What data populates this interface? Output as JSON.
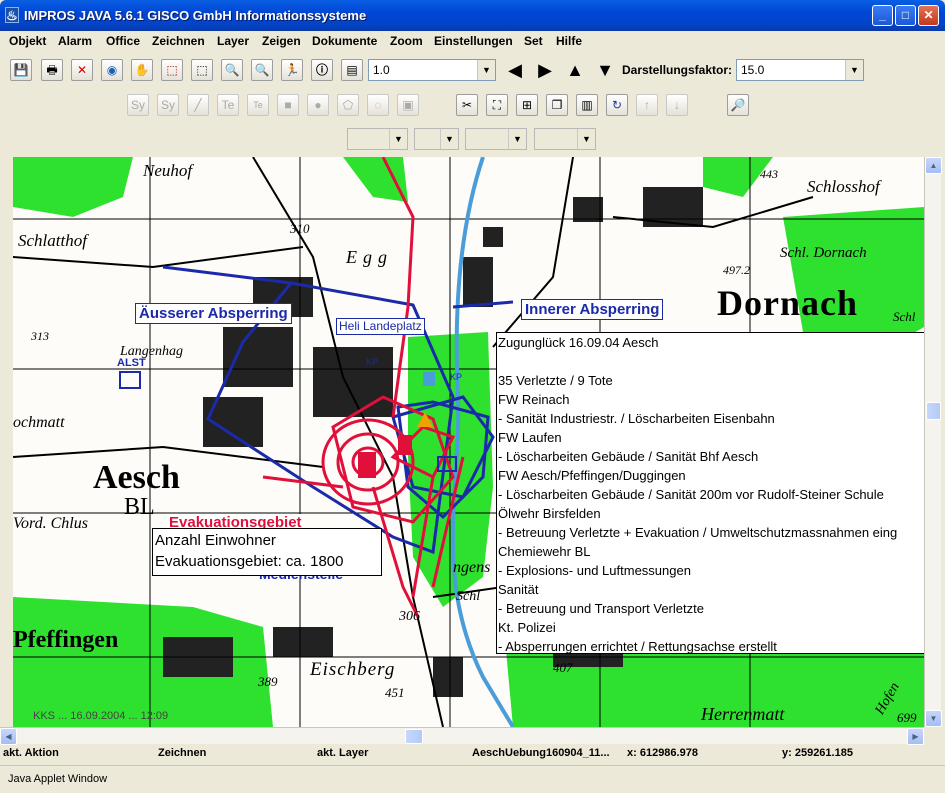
{
  "window": {
    "title": "IMPROS JAVA 5.6.1 GISCO GmbH Informationssysteme",
    "app_icon": "java-icon"
  },
  "menu": [
    "Objekt",
    "Alarm",
    "Office",
    "Zeichnen",
    "Layer",
    "Zeigen",
    "Dokumente",
    "Zoom",
    "Einstellungen",
    "Set",
    "Hilfe"
  ],
  "toolbar1": {
    "scale_value": "1.0",
    "darstellungsfaktor_label": "Darstellungsfaktor:",
    "darstellungsfaktor_value": "15.0"
  },
  "toolbar2": {
    "labels": [
      "Sy",
      "Sy",
      "Te",
      "Te"
    ]
  },
  "map": {
    "place_labels": [
      "Neuhof",
      "Schlatthof",
      "Egg",
      "310",
      "313",
      "Langenhag",
      "Dornach",
      "Schl. Dornach",
      "Schlosshof",
      "Aesch",
      "BL",
      "Pfeffingen",
      "Eischberg",
      "Herrenmatt",
      "306",
      "407",
      "451",
      "389",
      "443",
      "497.2",
      "Schl",
      "ochmatt",
      "Vord. Chlus",
      "ngens",
      "Schl",
      "KP",
      "KP",
      "ALST",
      "Hofen",
      "699"
    ],
    "overlays": {
      "aeusserer": "Äusserer Absperring",
      "heli": "Heli Landeplatz",
      "innerer": "Innerer Absperring",
      "evakuation": "Evakuationsgebiet",
      "medienstelle": "Medienstelle",
      "footer_note": "KKS ... 16.09.2004 ... 12:09"
    },
    "einwohner_box": [
      "Anzahl Einwohner",
      "Evakuationsgebiet: ca. 1800"
    ],
    "info_lines": [
      "Zugunglück 16.09.04 Aesch",
      "",
      "35 Verletzte / 9 Tote",
      "FW Reinach",
      "- Sanität Industriestr. / Löscharbeiten Eisenbahn",
      "FW Laufen",
      "- Löscharbeiten Gebäude / Sanität Bhf Aesch",
      "FW Aesch/Pfeffingen/Duggingen",
      "- Löscharbeiten Gebäude / Sanität 200m vor Rudolf-Steiner Schule",
      "Ölwehr Birsfelden",
      "- Betreuung Verletzte + Evakuation / Umweltschutzmassnahmen eing",
      "Chemiewehr BL",
      "- Explosions- und Luftmessungen",
      "Sanität",
      "- Betreuung und Transport Verletzte",
      "Kt. Polizei",
      "- Absperrungen errichtet / Rettungsachse erstellt"
    ],
    "colors": {
      "forest": "#2fe12f",
      "blue_overlay": "#1b2aa8",
      "red_overlay": "#e0103b",
      "water": "#4a9dd8"
    }
  },
  "status": {
    "akt_aktion": "akt. Aktion",
    "zeichnen": "Zeichnen",
    "akt_layer": "akt. Layer",
    "file": "AeschUebung160904_11...",
    "x": "x: 612986.978",
    "y": "y: 259261.185"
  },
  "applet": "Java Applet Window"
}
